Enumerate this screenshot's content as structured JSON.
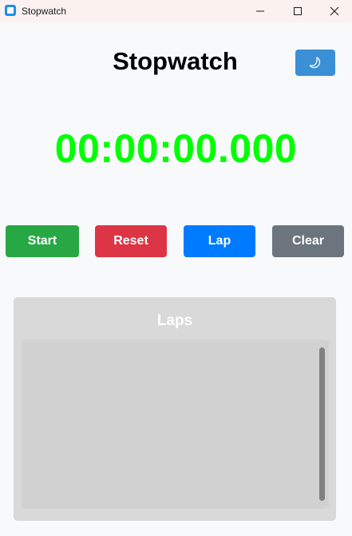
{
  "window": {
    "title": "Stopwatch",
    "controls": [
      "minimize",
      "maximize",
      "close"
    ]
  },
  "header": {
    "title": "Stopwatch",
    "theme_toggle_icon": "moon-icon"
  },
  "timer": {
    "display": "00:00:00.000",
    "color": "#00ff00"
  },
  "controls": {
    "start_label": "Start",
    "reset_label": "Reset",
    "lap_label": "Lap",
    "clear_label": "Clear",
    "colors": {
      "start": "#28a745",
      "reset": "#dc3545",
      "lap": "#007bff",
      "clear": "#6c757d"
    }
  },
  "laps": {
    "title": "Laps",
    "items": []
  }
}
